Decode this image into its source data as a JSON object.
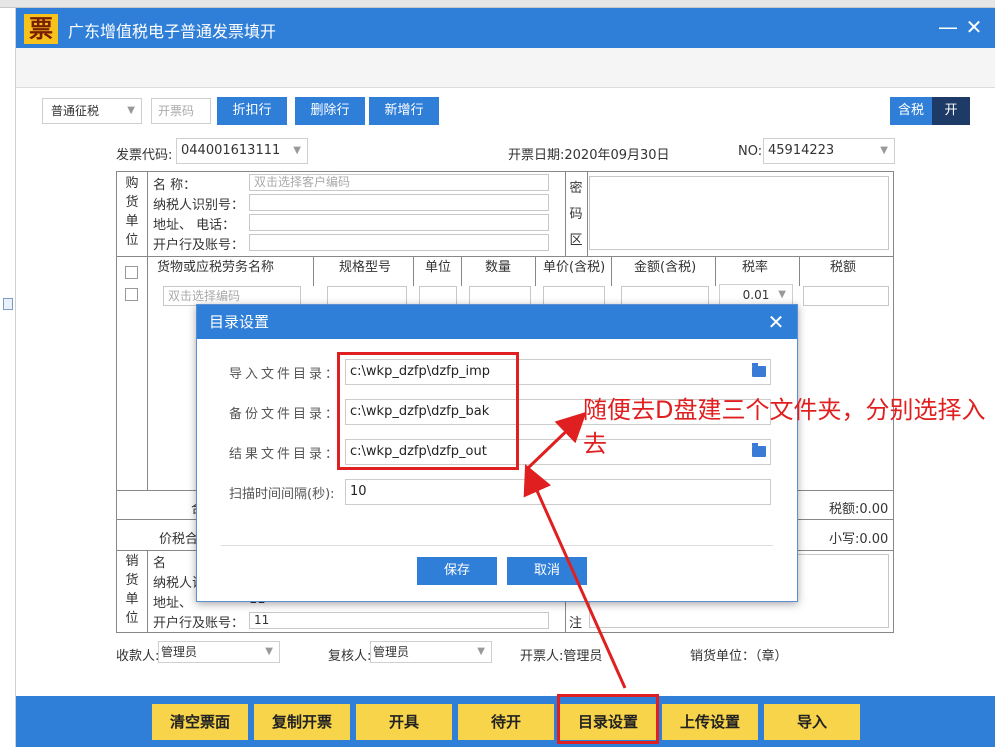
{
  "window": {
    "title": "广东增值税电子普通发票填开",
    "logo_char": "票",
    "minimize": "—",
    "close": "✕"
  },
  "toolbar": {
    "levy_type": "普通征税",
    "invoice_code_placeholder": "开票码",
    "discount_row": "折扣行",
    "delete_row": "删除行",
    "add_row": "新增行",
    "tax_inclusive": "含税",
    "toggle_on": "开"
  },
  "header": {
    "invoice_code_label": "发票代码:",
    "invoice_code": "044001613111",
    "date_label": "开票日期:",
    "date": "2020年09月30日",
    "no_label": "NO:",
    "no": "45914223"
  },
  "buyer": {
    "section": [
      "购",
      "货",
      "单",
      "位"
    ],
    "name_label": "名         称：",
    "name_placeholder": "双击选择客户编码",
    "taxid_label": "纳税人识别号：",
    "address_label": "地址、  电话：",
    "bank_label": "开户行及账号：",
    "cipher": [
      "密",
      "码",
      "区"
    ]
  },
  "items": {
    "columns": [
      "货物或应税劳务名称",
      "规格型号",
      "单位",
      "数量",
      "单价(含税)",
      "金额(含税)",
      "税率",
      "税额"
    ],
    "name_placeholder": "双击选择编码",
    "tax_rate": "0.01"
  },
  "totals": {
    "subtotal_label_fragment": "合",
    "tax_total": "税额:0.00",
    "total_label_fragment": "价税合",
    "small_total": "小写:0.00"
  },
  "seller": {
    "section": [
      "销",
      "货",
      "单",
      "位"
    ],
    "name_label": "名",
    "taxid_label": "纳税人识",
    "address_label": "地址、",
    "bank_label": "开户行及账号：",
    "bank_value": "11",
    "partial_value": "11",
    "note": "注"
  },
  "signers": {
    "payee_label": "收款人:",
    "payee": "管理员",
    "reviewer_label": "复核人:",
    "reviewer": "管理员",
    "issuer": "开票人:管理员",
    "seller_seal": "销货单位：（章）"
  },
  "dialog": {
    "title": "目录设置",
    "close": "✕",
    "import_label": "导入文件目录：",
    "import_dir": "c:\\wkp_dzfp\\dzfp_imp",
    "backup_label": "备份文件目录：",
    "backup_dir": "c:\\wkp_dzfp\\dzfp_bak",
    "result_label": "结果文件目录：",
    "result_dir": "c:\\wkp_dzfp\\dzfp_out",
    "interval_label": "扫描时间间隔(秒):",
    "interval": "10",
    "save": "保存",
    "cancel": "取消"
  },
  "annotation": {
    "text": "随便去D盘建三个文件夹，分别选择入去",
    "color": "#e02020"
  },
  "bottom_buttons": [
    "清空票面",
    "复制开票",
    "开具",
    "待开",
    "目录设置",
    "上传设置",
    "导入"
  ],
  "colors": {
    "primary": "#2f7fd8",
    "button_yellow": "#f8d44a",
    "highlight_red": "#e02020"
  }
}
